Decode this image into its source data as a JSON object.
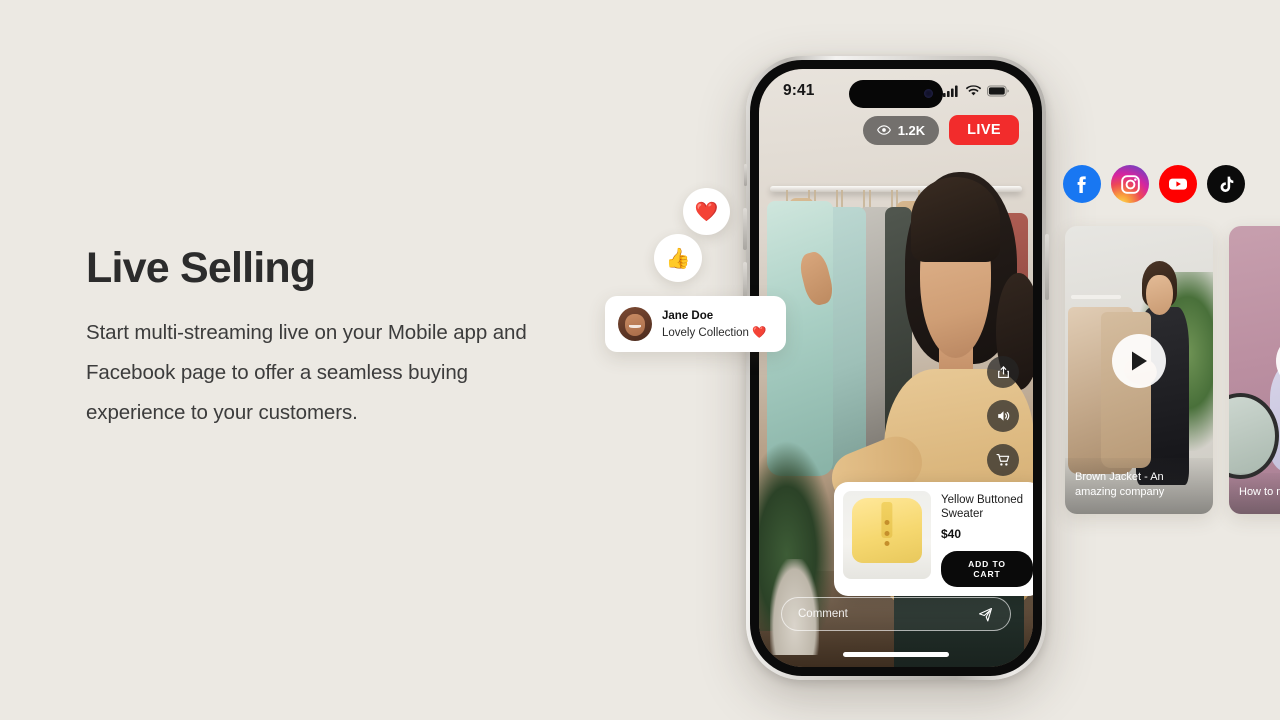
{
  "background_color": "#ECE9E3",
  "copy": {
    "title": "Live Selling",
    "body": "Start multi-streaming live on your Mobile app and Facebook page to offer a seamless buying experience to your customers."
  },
  "phone": {
    "status_bar": {
      "time": "9:41",
      "signal_icon": "cellular-signal-icon",
      "wifi_icon": "wifi-icon",
      "battery_icon": "battery-icon"
    },
    "badges": {
      "viewers_count": "1.2K",
      "viewers_icon": "eye-icon",
      "live_label": "LIVE",
      "live_color": "#F22C2C"
    },
    "actions": [
      {
        "name": "share-icon",
        "label": "Share"
      },
      {
        "name": "sound-icon",
        "label": "Sound"
      },
      {
        "name": "cart-icon",
        "label": "Cart"
      }
    ],
    "product_card": {
      "title": "Yellow Buttoned Sweater",
      "price": "$40",
      "button_label": "ADD TO CART",
      "thumbnail_alt": "yellow-cardigan-thumbnail"
    },
    "comment_bar": {
      "placeholder": "Comment",
      "send_icon": "send-icon"
    }
  },
  "overlays": {
    "reactions": [
      {
        "icon": "heart-emoji",
        "glyph": "❤️"
      },
      {
        "icon": "thumbs-up-emoji",
        "glyph": "👍"
      }
    ],
    "comment_card": {
      "author": "Jane Doe",
      "message": "Lovely Collection ❤️",
      "avatar_alt": "jane-doe-avatar"
    }
  },
  "socials": [
    {
      "name": "facebook-icon",
      "label": "Facebook",
      "color": "#1877F2"
    },
    {
      "name": "instagram-icon",
      "label": "Instagram",
      "color": "#D6249F"
    },
    {
      "name": "youtube-icon",
      "label": "YouTube",
      "color": "#FF0000"
    },
    {
      "name": "tiktok-icon",
      "label": "TikTok",
      "color": "#0B0B0B"
    }
  ],
  "video_cards": [
    {
      "caption": "Brown Jacket  - An amazing company",
      "play_icon": "play-icon"
    },
    {
      "caption": "How to makeup",
      "play_icon": "play-icon"
    }
  ]
}
